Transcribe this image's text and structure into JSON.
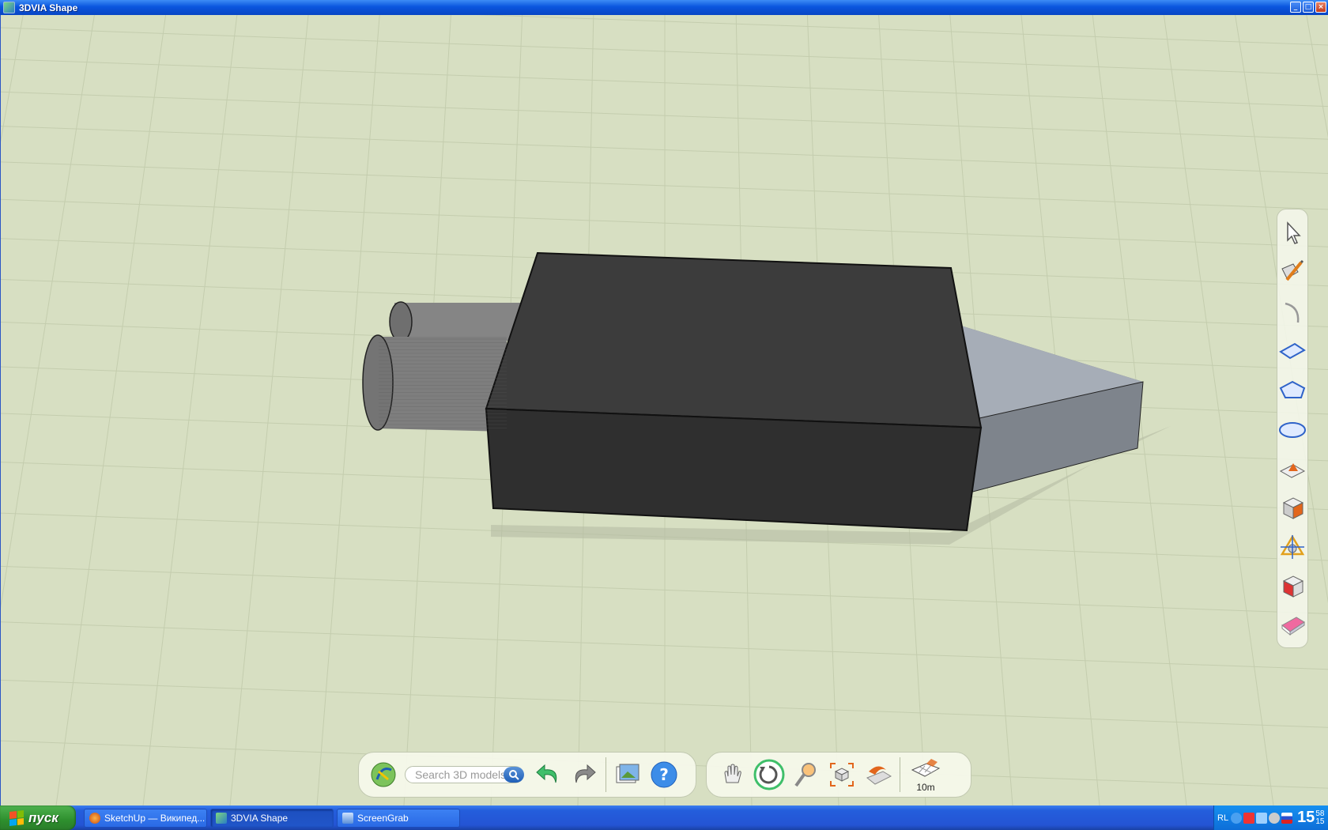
{
  "window": {
    "title": "3DVIA Shape",
    "buttons": {
      "minimize": "_",
      "maximize": "□",
      "close": "×"
    }
  },
  "right_toolbar": {
    "tools": [
      {
        "name": "select-tool-icon"
      },
      {
        "name": "line-tool-icon"
      },
      {
        "name": "arc-tool-icon"
      },
      {
        "name": "rectangle-tool-icon"
      },
      {
        "name": "polygon-tool-icon"
      },
      {
        "name": "circle-tool-icon"
      },
      {
        "name": "push-pull-tool-icon"
      },
      {
        "name": "box-tool-icon"
      },
      {
        "name": "move-rotate-tool-icon"
      },
      {
        "name": "paint-tool-icon"
      },
      {
        "name": "eraser-tool-icon"
      }
    ]
  },
  "bottom_toolbar": {
    "search_placeholder": "Search 3D models",
    "scale_label": "10m"
  },
  "taskbar": {
    "start_label": "пуск",
    "tasks": [
      {
        "label": "SketchUp — Википед...",
        "active": false
      },
      {
        "label": "3DVIA Shape",
        "active": true
      },
      {
        "label": "ScreenGrab",
        "active": false
      }
    ],
    "tray": {
      "lang": "RL",
      "clock_hour": "15",
      "clock_min_top": "58",
      "clock_min_bottom": "15"
    }
  },
  "colors": {
    "ground": "#d7dfc2",
    "grid_line": "#c4cdae",
    "box_top": "#3a3a3a",
    "box_front": "#303030",
    "cylinder": "#7c7c7c",
    "wedge": "#9aa2ad",
    "titlebar": "#0a55de"
  }
}
